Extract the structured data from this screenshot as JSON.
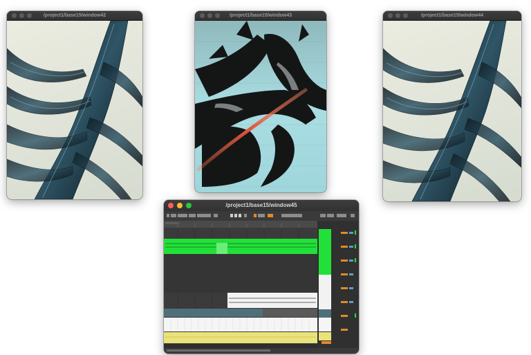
{
  "windows": [
    {
      "title": "/project1/base15/window42"
    },
    {
      "title": "/project1/base15/window43"
    },
    {
      "title": "/project1/base15/window44"
    },
    {
      "title": "/project1/base15/window45"
    }
  ],
  "colors": {
    "accent_green": "#22e03a",
    "clip_yellow": "#eae27a",
    "clip_blue": "#4f6f7a",
    "laser_red": "#e0553c",
    "cyan_bg": "#9fd6dc"
  },
  "icons": [
    "close-dot",
    "minimize-dot",
    "zoom-dot"
  ]
}
